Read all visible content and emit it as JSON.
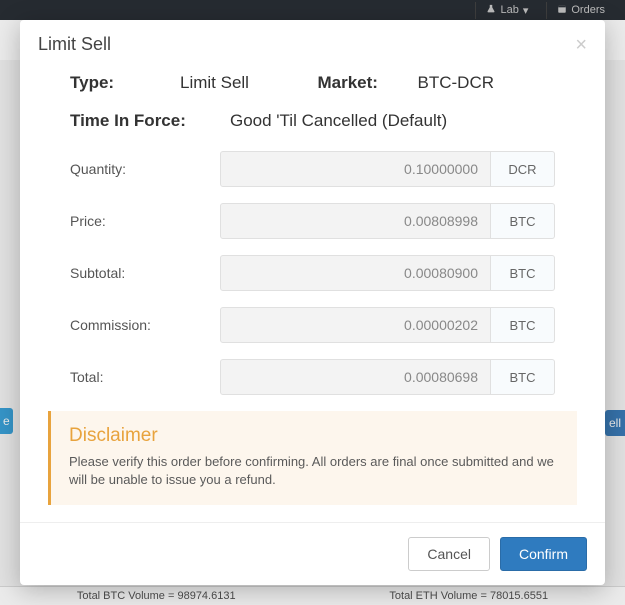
{
  "topnav": {
    "lab": "Lab",
    "orders": "Orders"
  },
  "background": {
    "btc_volume": "Total BTC Volume = 98974.6131",
    "eth_volume": "Total ETH Volume = 78015.6551",
    "sell_chip": "ell",
    "left_chip": "e"
  },
  "modal": {
    "title": "Limit Sell",
    "type_label": "Type:",
    "type_value": "Limit Sell",
    "market_label": "Market:",
    "market_value": "BTC-DCR",
    "tif_label": "Time In Force:",
    "tif_value": "Good 'Til Cancelled (Default)",
    "rows": {
      "quantity": {
        "label": "Quantity:",
        "value": "0.10000000",
        "unit": "DCR"
      },
      "price": {
        "label": "Price:",
        "value": "0.00808998",
        "unit": "BTC"
      },
      "subtotal": {
        "label": "Subtotal:",
        "value": "0.00080900",
        "unit": "BTC"
      },
      "commission": {
        "label": "Commission:",
        "value": "0.00000202",
        "unit": "BTC"
      },
      "total": {
        "label": "Total:",
        "value": "0.00080698",
        "unit": "BTC"
      }
    },
    "disclaimer": {
      "title": "Disclaimer",
      "text": "Please verify this order before confirming. All orders are final once submitted and we will be unable to issue you a refund."
    },
    "buttons": {
      "cancel": "Cancel",
      "confirm": "Confirm"
    }
  }
}
